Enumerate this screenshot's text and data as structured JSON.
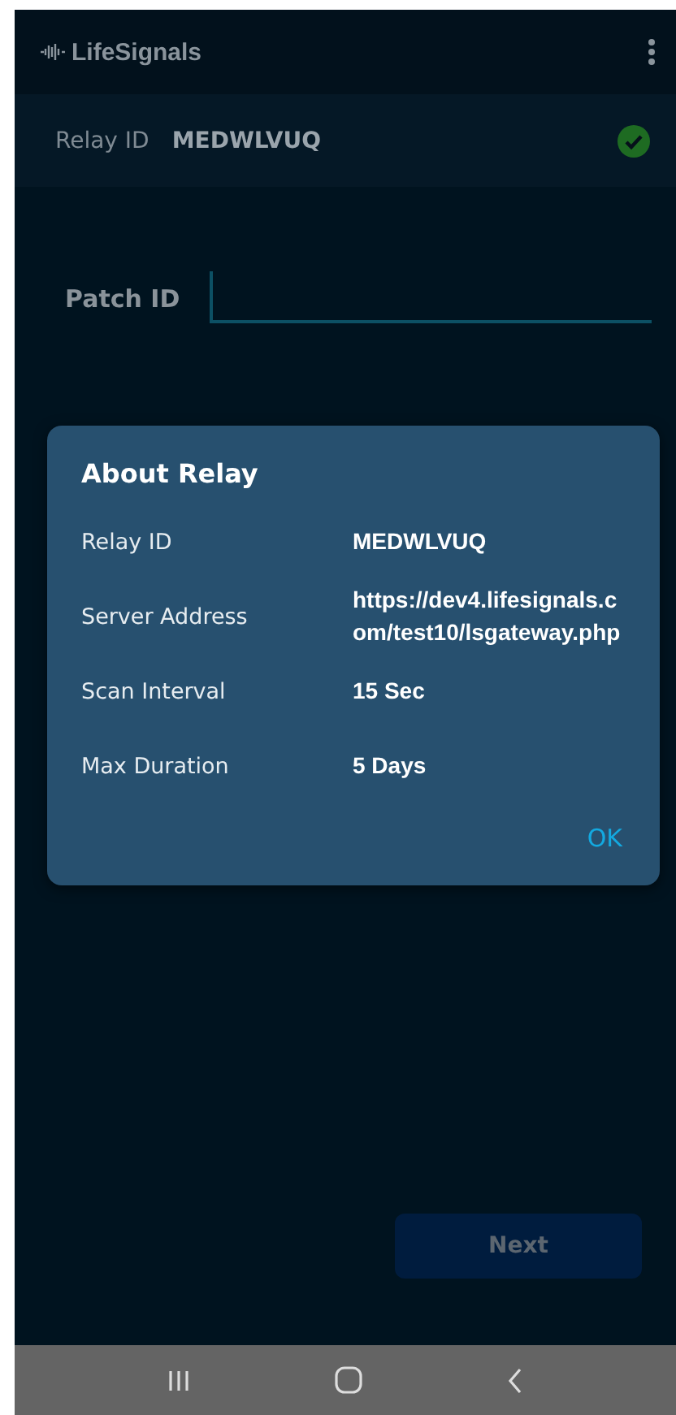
{
  "app_bar": {
    "title": "LifeSignals"
  },
  "relay": {
    "label": "Relay ID",
    "value": "MEDWLVUQ",
    "connected": true
  },
  "patch": {
    "label": "Patch ID"
  },
  "next_button": {
    "label": "Next",
    "disabled": true
  },
  "dialog": {
    "title": "About Relay",
    "rows": [
      {
        "label": "Relay ID",
        "value": "MEDWLVUQ"
      },
      {
        "label": "Server Address",
        "value": "https://dev4.lifesignals.com/test10/lsgateway.php"
      },
      {
        "label": "Scan Interval",
        "value": "15 Sec"
      },
      {
        "label": "Max Duration",
        "value": "5 Days"
      }
    ],
    "button": "OK"
  }
}
